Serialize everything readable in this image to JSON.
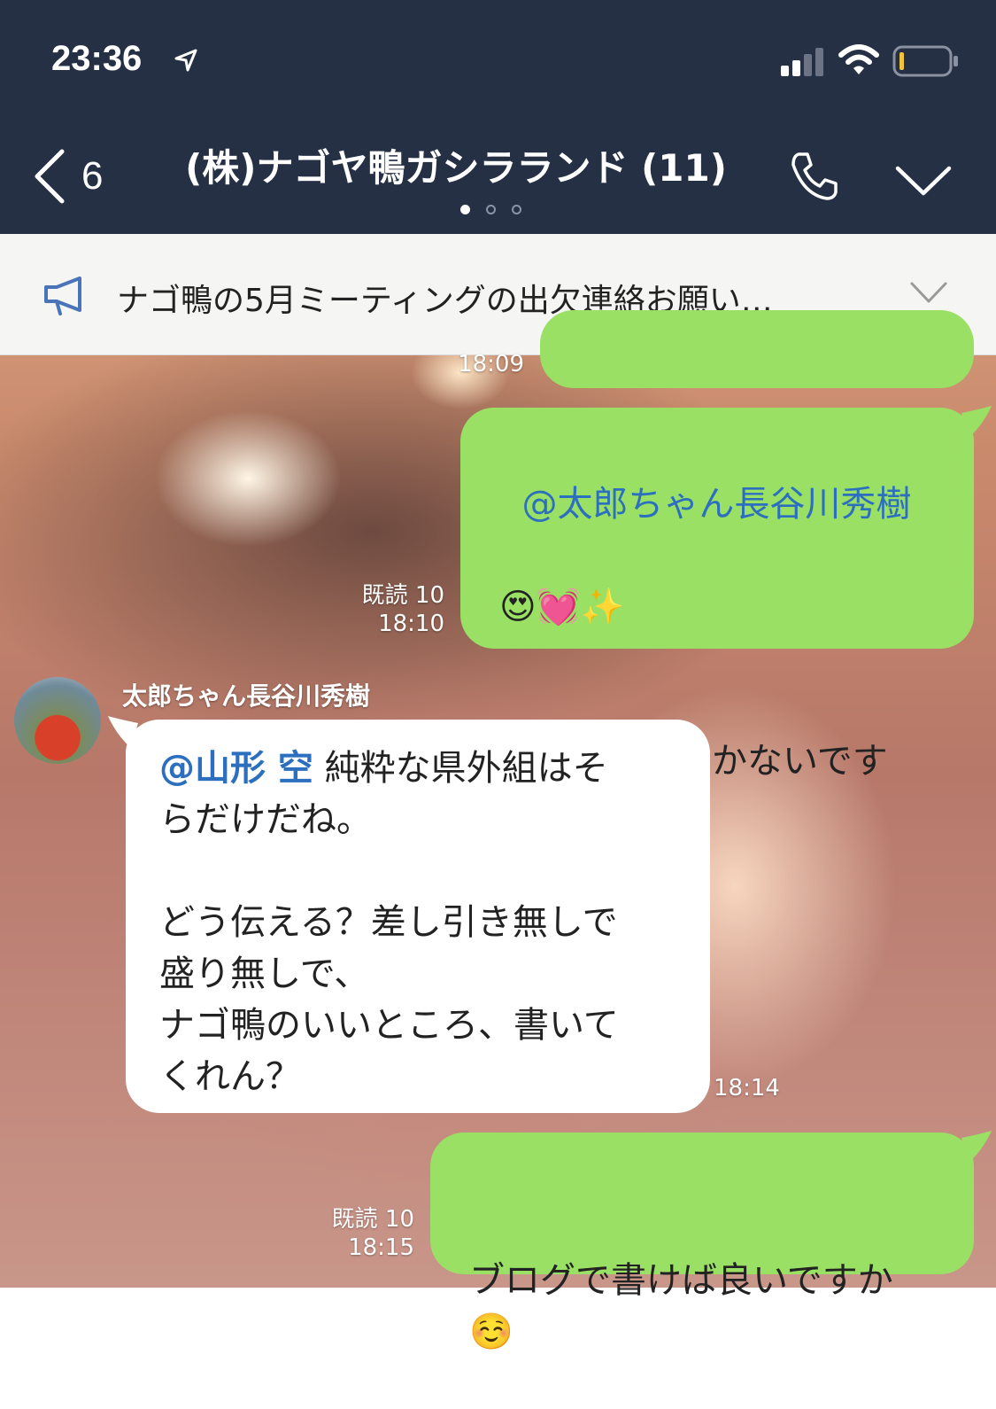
{
  "status_bar": {
    "time": "23:36"
  },
  "header": {
    "back_count": "6",
    "title": "(株)ナゴヤ鴨ガシラランド (11)"
  },
  "announcement": {
    "text": "ナゴ鴨の5月ミーティングの出欠連絡お願い…"
  },
  "messages": [
    {
      "time": "18:09"
    },
    {
      "mention": "@太郎ちゃん長谷川秀樹",
      "emoji": "😍💓✨",
      "text": "ほんと愛でしかないです\nね❣️",
      "read": "既読 10",
      "time": "18:10"
    },
    {
      "sender": "太郎ちゃん長谷川秀樹",
      "mention": "@山形 空",
      "text": " 純粋な県外組はそ\nらだけだね。\n\nどう伝える？差し引き無しで\n盛り無しで、\nナゴ鴨のいいところ、書いて\nくれん？",
      "time": "18:14"
    },
    {
      "text": "ブログで書けば良いですか\n☺️",
      "read": "既読 10",
      "time": "18:15"
    }
  ],
  "colors": {
    "header_bg": "#253045",
    "bubble_green": "#99e064",
    "mention": "#2c6fbf"
  }
}
